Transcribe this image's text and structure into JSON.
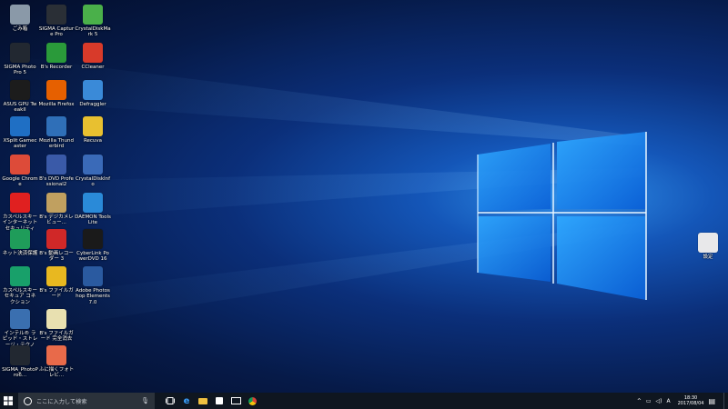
{
  "desktop_icons": [
    {
      "label": "ごみ箱",
      "icon": "recycle-bin-icon",
      "color": "#8a99a8"
    },
    {
      "label": "SIGMA Photo Pro 5",
      "icon": "sigma-photo-pro-icon",
      "color": "#222831"
    },
    {
      "label": "ASUS GPU TweakII",
      "icon": "asus-gpu-tweak-icon",
      "color": "#1c1c1c"
    },
    {
      "label": "XSplit Gamecaster",
      "icon": "xsplit-gamecaster-icon",
      "color": "#1f6fc4"
    },
    {
      "label": "Google Chrome",
      "icon": "chrome-icon",
      "color": "#dd4b39"
    },
    {
      "label": "カスペルスキー インターネット セキュリティ",
      "icon": "kaspersky-icon",
      "color": "#e02020"
    },
    {
      "label": "ネット決済保護",
      "icon": "safe-money-icon",
      "color": "#1f9c5a"
    },
    {
      "label": "カスペルスキー セキュア コネクション",
      "icon": "secure-connection-icon",
      "color": "#18a06a"
    },
    {
      "label": "インテル® ラピッド・ストレージ・テクノロ...",
      "icon": "intel-rst-icon",
      "color": "#3a6fb0"
    },
    {
      "label": "SIGMA_PhotoPro6...",
      "icon": "sigma-photo-pro6-icon",
      "color": "#222831"
    },
    {
      "label": "SIGMA Capture Pro",
      "icon": "sigma-capture-pro-icon",
      "color": "#2a2f36"
    },
    {
      "label": "B's Recorder",
      "icon": "bs-recorder-icon",
      "color": "#2a9a3a"
    },
    {
      "label": "Mozilla Firefox",
      "icon": "firefox-icon",
      "color": "#e66000"
    },
    {
      "label": "Mozilla Thunderbird",
      "icon": "thunderbird-icon",
      "color": "#2f6fb8"
    },
    {
      "label": "B's DVD Professional2",
      "icon": "bs-dvd-icon",
      "color": "#3a5aa8"
    },
    {
      "label": "B's デジカメレビュー...",
      "icon": "bs-camera-review-icon",
      "color": "#c0a060"
    },
    {
      "label": "B's 動画レコーダー 3",
      "icon": "bs-video-recorder-icon",
      "color": "#d02828"
    },
    {
      "label": "B's ファイルガード",
      "icon": "bs-file-guard-icon",
      "color": "#e8b820"
    },
    {
      "label": "B's ファイルガード 完全消去",
      "icon": "bs-file-erase-icon",
      "color": "#e8e0b0"
    },
    {
      "label": "ふに描くフォトレビ...",
      "icon": "photo-review-icon",
      "color": "#e86a4a"
    },
    {
      "label": "CrystalDiskMark 5",
      "icon": "crystaldiskmark-icon",
      "color": "#4ab04a"
    },
    {
      "label": "CCleaner",
      "icon": "ccleaner-icon",
      "color": "#d83a2a"
    },
    {
      "label": "Defraggler",
      "icon": "defraggler-icon",
      "color": "#3a8ad8"
    },
    {
      "label": "Recuva",
      "icon": "recuva-icon",
      "color": "#e8c030"
    },
    {
      "label": "CrystalDiskInfo",
      "icon": "crystaldiskinfo-icon",
      "color": "#3a6ab8"
    },
    {
      "label": "DAEMON Tools Lite",
      "icon": "daemon-tools-icon",
      "color": "#2a8ad8"
    },
    {
      "label": "CyberLink PowerDVD 16",
      "icon": "powerdvd-icon",
      "color": "#1a1a1a"
    },
    {
      "label": "Adobe Photoshop Elements 7.0",
      "icon": "photoshop-elements-icon",
      "color": "#2a5aa0"
    },
    {
      "label": "設定",
      "icon": "settings-file-icon",
      "color": "#e8e8ea"
    }
  ],
  "taskbar": {
    "search_placeholder": "ここに入力して検索",
    "ime_label": "A",
    "time": "18:30",
    "date": "2017/08/04"
  }
}
